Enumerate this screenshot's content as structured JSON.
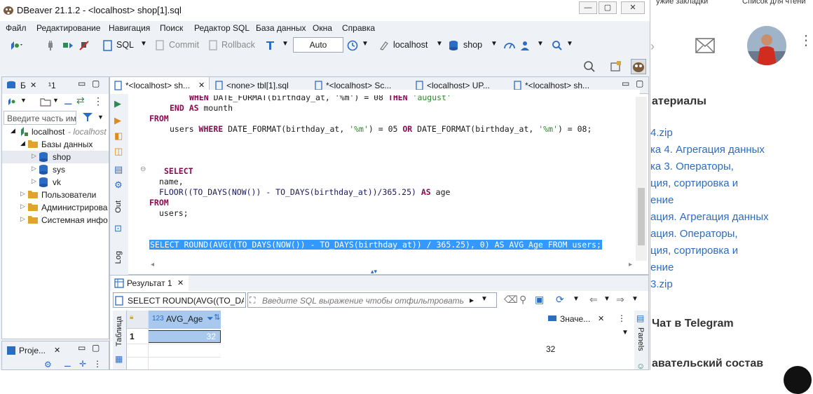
{
  "window": {
    "title": "DBeaver 21.1.2 - <localhost> shop[1].sql",
    "min_label": "—",
    "max_label": "▢",
    "close_label": "✕"
  },
  "menu": [
    "Файл",
    "Редактирование",
    "Навигация",
    "Поиск",
    "Редактор SQL",
    "База данных",
    "Окна",
    "Справка"
  ],
  "toolbar": {
    "sql_label": "SQL",
    "commit_label": "Commit",
    "rollback_label": "Rollback",
    "mode_label": "Auto",
    "connection_label": "localhost",
    "schema_label": "shop"
  },
  "left_panel": {
    "tab1": "Б",
    "tab2": "¹1",
    "filter_placeholder": "Введите часть им",
    "tree": [
      {
        "label": "localhost",
        "suffix": " - localhost"
      },
      {
        "label": "Базы данных"
      },
      {
        "label": "shop"
      },
      {
        "label": "sys"
      },
      {
        "label": "vk"
      },
      {
        "label": "Пользователи"
      },
      {
        "label": "Администрирова"
      },
      {
        "label": "Системная инфо"
      }
    ],
    "projects_label": "Proje..."
  },
  "editor": {
    "tabs": [
      {
        "label": "*<localhost> sh...",
        "active": true
      },
      {
        "label": "<none> tbl[1].sql",
        "active": false
      },
      {
        "label": "*<localhost> Sc...",
        "active": false
      },
      {
        "label": "<localhost> UP...",
        "active": false
      },
      {
        "label": "*<localhost> sh...",
        "active": false
      }
    ],
    "side_tabs": {
      "out": "Out",
      "log": "Log"
    },
    "code": {
      "l0_kw1": "WHEN",
      "l0_rest": " DATE_FORMAT(birthday_at, '%m') = 08 ",
      "l0_kw2": "THEN",
      "l0_str": " 'august'",
      "l1_kw": "END AS",
      "l1_rest": " mounth",
      "l2_kw": "FROM",
      "l3_pre": "users ",
      "l3_kw1": "WHERE",
      "l3_mid": " DATE_FORMAT(birthday_at, ",
      "l3_s1": "'%m'",
      "l3_mid2": ") = 05 ",
      "l3_kw2": "OR",
      "l3_mid3": " DATE_FORMAT(birthday_at, ",
      "l3_s2": "'%m'",
      "l3_end": ") = 08;",
      "l4_kw": "SELECT",
      "l5": "name,",
      "l6_fn": "FLOOR((TO_DAYS(NOW()) - TO_DAYS(birthday_at))/365.25) ",
      "l6_kw": "AS",
      "l6_end": " age",
      "l7_kw": "FROM",
      "l8": "users;",
      "l9": "SELECT ROUND(AVG((TO_DAYS(NOW()) - TO_DAYS(birthday_at)) / 365.25), 0) AS AVG_Age FROM users;"
    }
  },
  "results": {
    "tab_label": "Результат 1",
    "query_label": "SELECT ROUND(AVG((TO_DAY!",
    "filter_placeholder": "Введите SQL выражение чтобы отфильтровать р",
    "side_label": "Таблица",
    "column_type": "123",
    "column_name": "AVG_Age",
    "rows": [
      {
        "num": "1",
        "value": "32"
      }
    ],
    "value_panel_label": "Значе...",
    "value_panel_value": "32",
    "panels_label": "Panels"
  },
  "background_page": {
    "heading": "атериалы",
    "links": [
      "4.zip",
      "ка 4. Агрегация данных",
      "ка 3. Операторы,",
      "ция, сортировка и",
      "ение",
      "ация. Агрегация данных",
      "ация. Операторы,",
      "ция, сортировка и",
      "ение",
      "3.zip"
    ],
    "telegram": "Чат в Telegram",
    "team": "авательский состав",
    "top_link1": "ужие закладки",
    "top_link2": "Список для чтени",
    "accent": "#2b6cc4"
  },
  "colors": {
    "keyword": "#8b0a50",
    "string": "#2a8a2a",
    "selection": "#3399ff",
    "result_cell": "#a8c8ee",
    "window_bg": "#eef1f6"
  }
}
